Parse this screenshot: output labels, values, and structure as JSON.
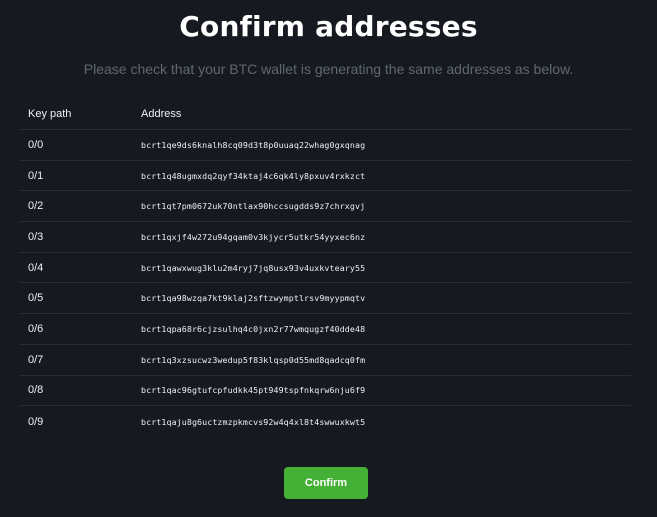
{
  "header": {
    "title": "Confirm addresses",
    "subtitle": "Please check that your BTC wallet is generating the same addresses as below."
  },
  "table": {
    "columns": {
      "key_path": "Key path",
      "address": "Address"
    },
    "rows": [
      {
        "key_path": "0/0",
        "address": "bcrt1qe9ds6knalh8cq09d3t8p0uuaq22whag0gxqnag"
      },
      {
        "key_path": "0/1",
        "address": "bcrt1q48ugmxdq2qyf34ktaj4c6qk4ly8pxuv4rxkzct"
      },
      {
        "key_path": "0/2",
        "address": "bcrt1qt7pm0672uk70ntlax90hccsugdds9z7chrxgvj"
      },
      {
        "key_path": "0/3",
        "address": "bcrt1qxjf4w272u94gqam0v3kjycr5utkr54yyxec6nz"
      },
      {
        "key_path": "0/4",
        "address": "bcrt1qawxwug3klu2m4ryj7jq8usx93v4uxkvteary55"
      },
      {
        "key_path": "0/5",
        "address": "bcrt1qa98wzqa7kt9klaj2sftzwymptlrsv9myypmqtv"
      },
      {
        "key_path": "0/6",
        "address": "bcrt1qpa68r6cjzsulhq4c0jxn2r77wmqugzf40dde48"
      },
      {
        "key_path": "0/7",
        "address": "bcrt1q3xzsucwz3wedup5f83klqsp0d55md8qadcq0fm"
      },
      {
        "key_path": "0/8",
        "address": "bcrt1qac96gtufcpfudkk45pt949tspfnkqrw6nju6f9"
      },
      {
        "key_path": "0/9",
        "address": "bcrt1qaju8g6uctzmzpkmcvs92w4q4xl8t4swwuxkwt5"
      }
    ]
  },
  "actions": {
    "confirm_label": "Confirm"
  },
  "colors": {
    "background": "#161a20",
    "accent_button": "#44b035",
    "subtitle": "#5f6771",
    "row_divider": "#262c34"
  }
}
